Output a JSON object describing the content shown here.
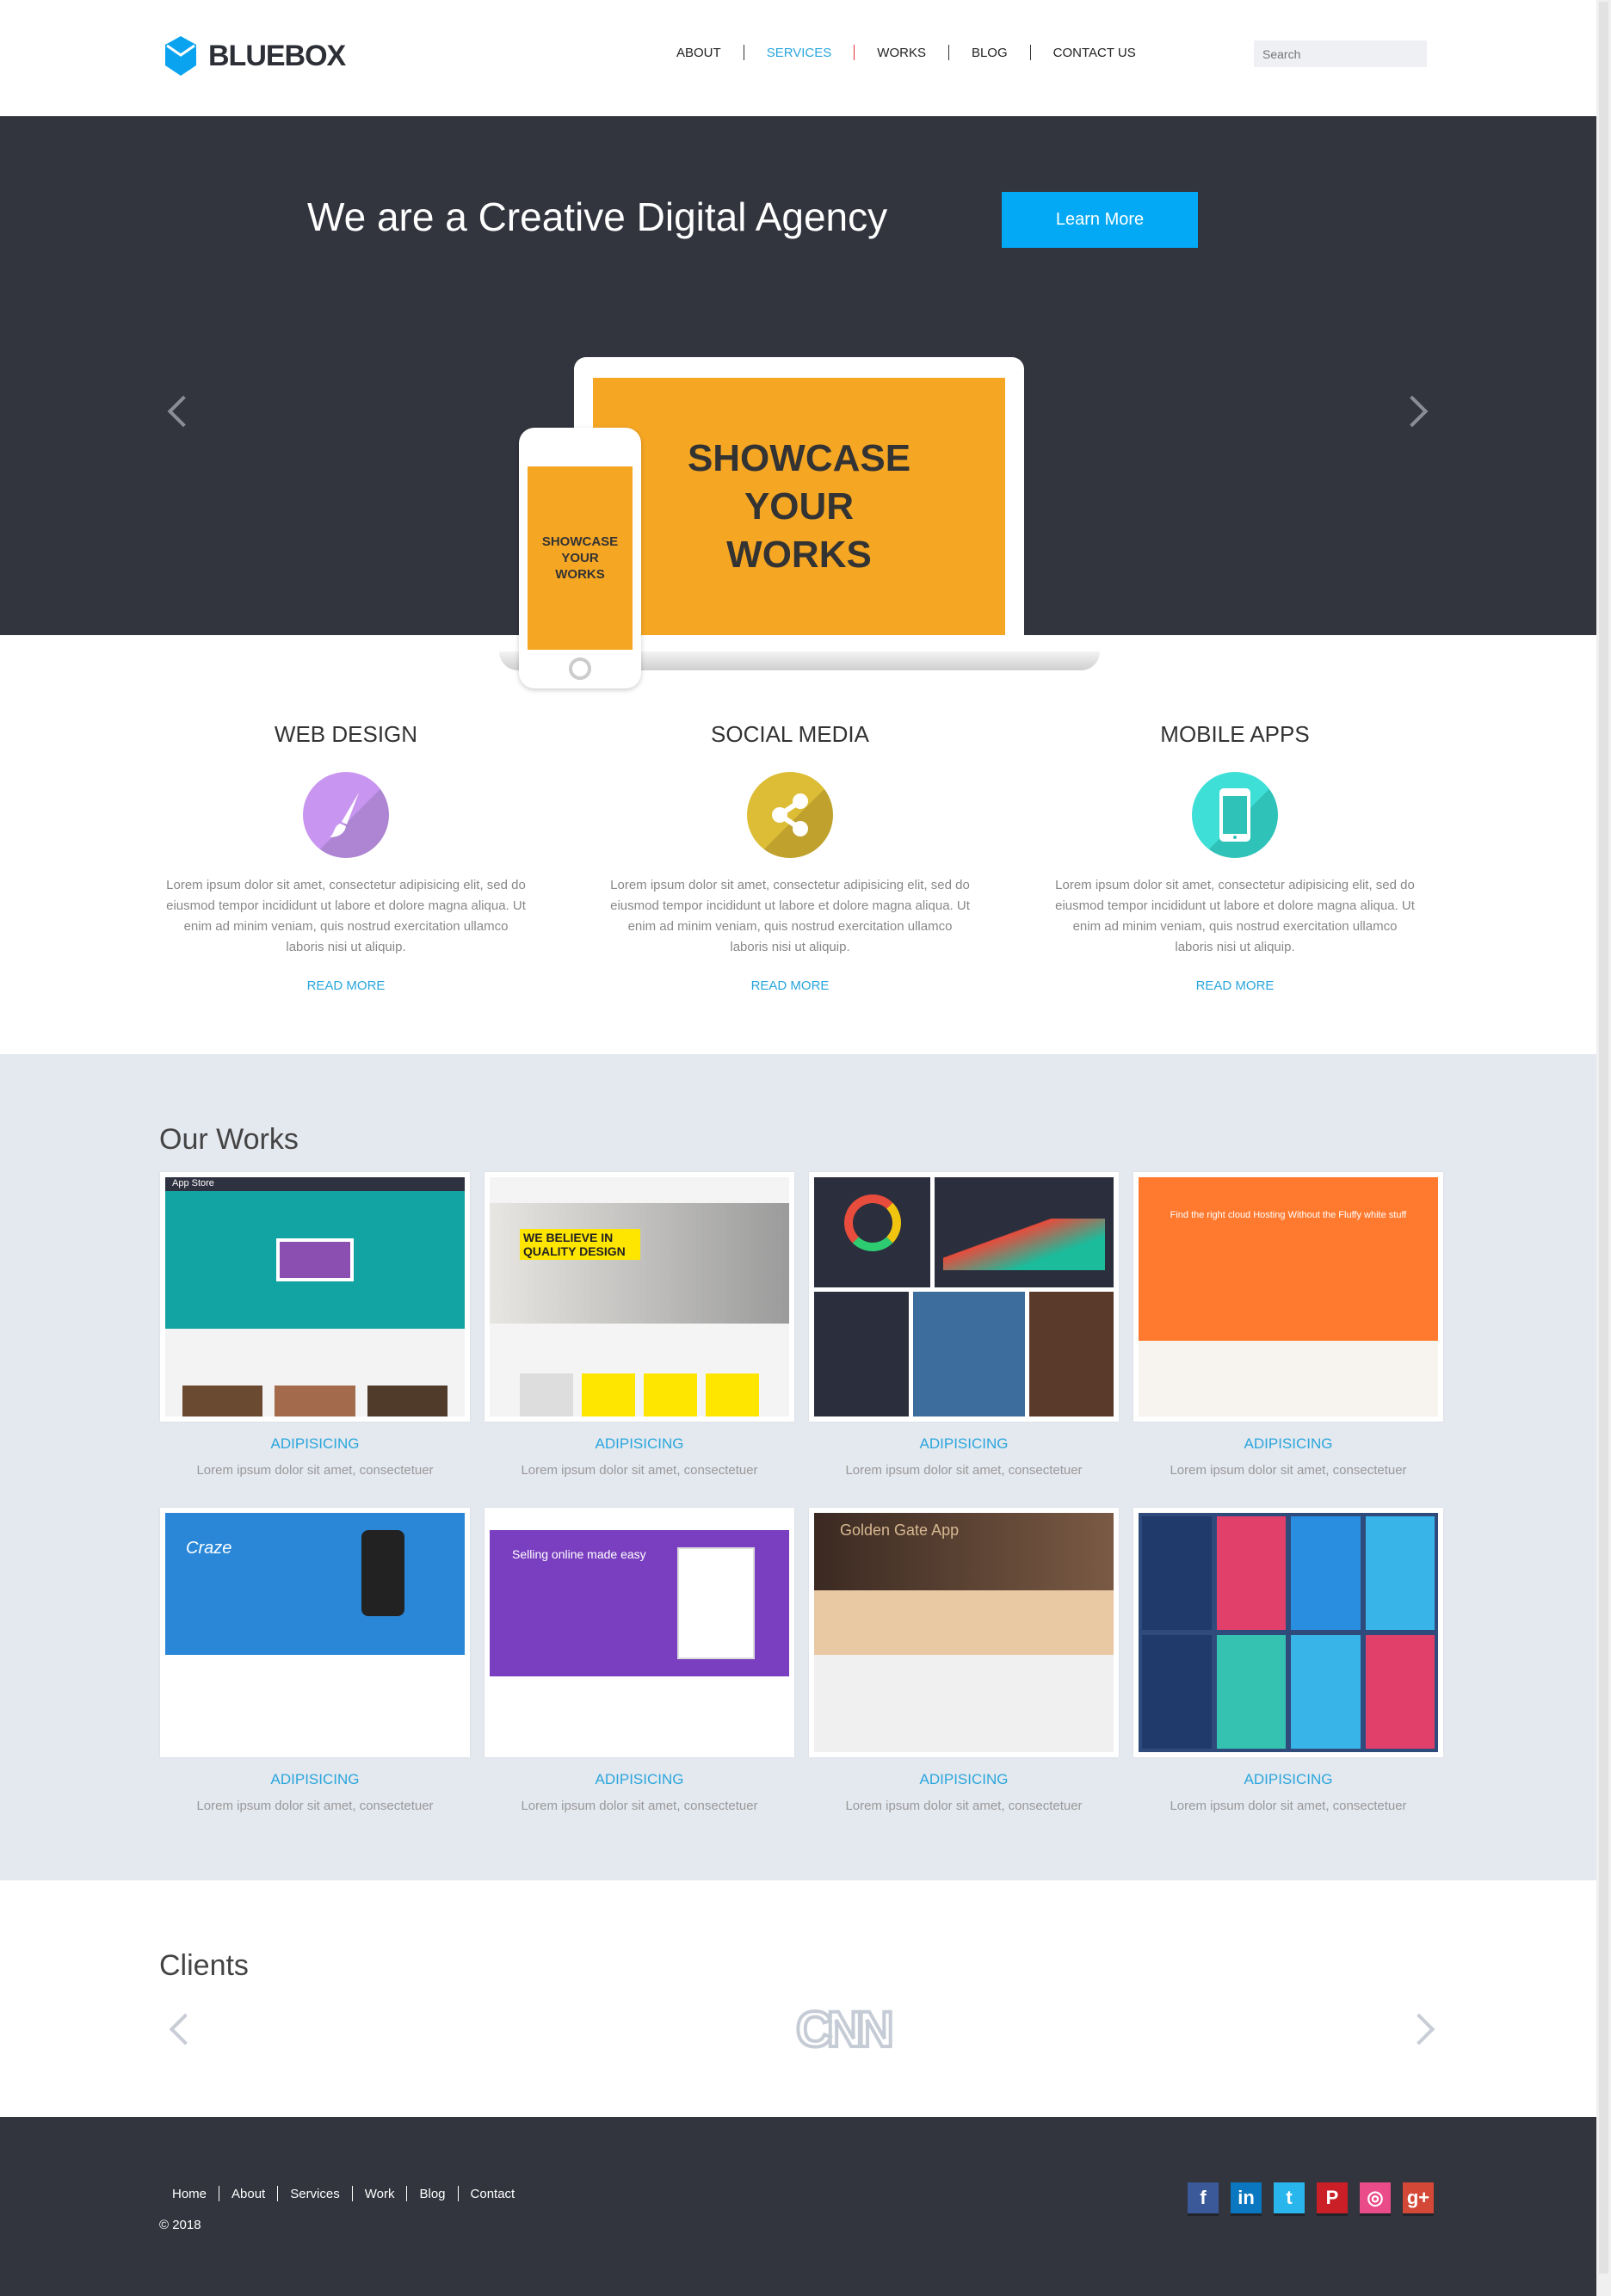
{
  "header": {
    "brand": "BLUEBOX",
    "nav": [
      {
        "label": "ABOUT"
      },
      {
        "label": "SERVICES",
        "active": true
      },
      {
        "label": "WORKS"
      },
      {
        "label": "BLOG"
      },
      {
        "label": "CONTACT US"
      }
    ],
    "search_placeholder": "Search"
  },
  "hero": {
    "title": "We are a Creative Digital Agency",
    "button": "Learn More",
    "laptop_text": "SHOWCASE YOUR WORKS",
    "phone_text": "SHOWCASE YOUR WORKS"
  },
  "services": [
    {
      "title": "WEB DESIGN",
      "icon": "paintbrush-icon",
      "color": "#c896f0",
      "text": "Lorem ipsum dolor sit amet, consectetur adipisicing elit, sed do eiusmod tempor incididunt ut labore et dolore magna aliqua. Ut enim ad minim veniam, quis nostrud exercitation ullamco laboris nisi ut aliquip.",
      "link": "READ MORE"
    },
    {
      "title": "SOCIAL MEDIA",
      "icon": "share-icon",
      "color": "#dcbd35",
      "text": "Lorem ipsum dolor sit amet, consectetur adipisicing elit, sed do eiusmod tempor incididunt ut labore et dolore magna aliqua. Ut enim ad minim veniam, quis nostrud exercitation ullamco laboris nisi ut aliquip.",
      "link": "READ MORE"
    },
    {
      "title": "MOBILE APPS",
      "icon": "smartphone-icon",
      "color": "#3ddfd6",
      "text": "Lorem ipsum dolor sit amet, consectetur adipisicing elit, sed do eiusmod tempor incididunt ut labore et dolore magna aliqua. Ut enim ad minim veniam, quis nostrud exercitation ullamco laboris nisi ut aliquip.",
      "link": "READ MORE"
    }
  ],
  "works": {
    "title": "Our Works",
    "items": [
      {
        "caption": "ADIPISICING",
        "text": "Lorem ipsum dolor sit amet, consectetuer",
        "thumb": "App Store"
      },
      {
        "caption": "ADIPISICING",
        "text": "Lorem ipsum dolor sit amet, consectetuer",
        "thumb": "WE BELIEVE IN QUALITY DESIGN"
      },
      {
        "caption": "ADIPISICING",
        "text": "Lorem ipsum dolor sit amet, consectetuer",
        "thumb": ""
      },
      {
        "caption": "ADIPISICING",
        "text": "Lorem ipsum dolor sit amet, consectetuer",
        "thumb": "Find the right cloud Hosting Without the Fluffy white stuff"
      },
      {
        "caption": "ADIPISICING",
        "text": "Lorem ipsum dolor sit amet, consectetuer",
        "thumb": "Craze"
      },
      {
        "caption": "ADIPISICING",
        "text": "Lorem ipsum dolor sit amet, consectetuer",
        "thumb": "Selling online made easy"
      },
      {
        "caption": "ADIPISICING",
        "text": "Lorem ipsum dolor sit amet, consectetuer",
        "thumb": "Golden Gate App"
      },
      {
        "caption": "ADIPISICING",
        "text": "Lorem ipsum dolor sit amet, consectetuer",
        "thumb": ""
      }
    ]
  },
  "clients": {
    "title": "Clients",
    "logo": "CNN"
  },
  "footer": {
    "links": [
      "Home",
      "About",
      "Services",
      "Work",
      "Blog",
      "Contact"
    ],
    "copyright": "© 2018",
    "social": [
      {
        "name": "facebook",
        "glyph": "f",
        "color": "#3b5998"
      },
      {
        "name": "linkedin",
        "glyph": "in",
        "color": "#0a77c0"
      },
      {
        "name": "twitter",
        "glyph": "t",
        "color": "#29b6ec"
      },
      {
        "name": "pinterest",
        "glyph": "P",
        "color": "#cb1f27"
      },
      {
        "name": "dribbble",
        "glyph": "◎",
        "color": "#ea4c89"
      },
      {
        "name": "google-plus",
        "glyph": "g+",
        "color": "#d34836"
      }
    ]
  }
}
